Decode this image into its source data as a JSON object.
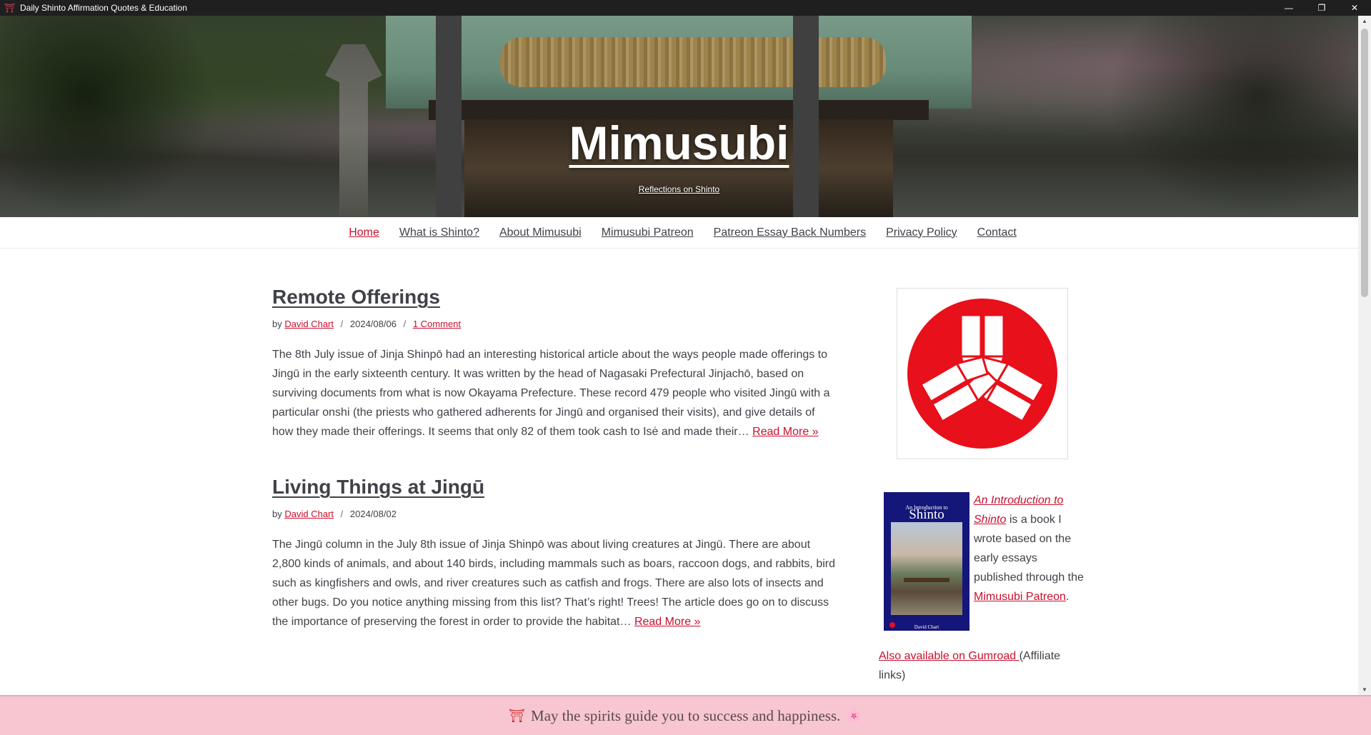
{
  "window": {
    "title": "Daily Shinto Affirmation Quotes & Education",
    "icon": "torii-icon",
    "controls": {
      "minimize": "—",
      "restore": "❐",
      "close": "✕"
    }
  },
  "hero": {
    "site_title": "Mimusubi",
    "tagline": "Reflections on Shinto"
  },
  "nav": {
    "items": [
      {
        "label": "Home",
        "active": true
      },
      {
        "label": "What is Shinto?"
      },
      {
        "label": "About Mimusubi"
      },
      {
        "label": "Mimusubi Patreon"
      },
      {
        "label": "Patreon Essay Back Numbers"
      },
      {
        "label": "Privacy Policy"
      },
      {
        "label": "Contact"
      }
    ]
  },
  "posts": [
    {
      "title": "Remote Offerings",
      "by": "by",
      "author": "David Chart",
      "sep": "/",
      "date": "2024/08/06",
      "comments": "1 Comment",
      "excerpt": "The 8th July issue of Jinja Shinpō had an interesting historical article about the ways people made offerings to Jingū in the early sixteenth century. It was written by the head of Nagasaki Prefectural Jinjachō, based on surviving documents from what is now Okayama Prefecture. These record 479 people who visited Jingū with a particular onshi (the priests who gathered adherents for Jingū and organised their visits), and give details of how they made their offerings. It seems that only 82 of them took cash to Isė and made their…",
      "read_more": "Read More »"
    },
    {
      "title": "Living Things at Jingū",
      "by": "by",
      "author": "David Chart",
      "sep": "/",
      "date": "2024/08/02",
      "excerpt": "The Jingū column in the July 8th issue of Jinja Shinpō was about living creatures at Jingū. There are about 2,800 kinds of animals, and about 140 birds, including mammals such as boars, raccoon dogs, and rabbits, bird such as kingfishers and owls, and river creatures such as catfish and frogs. There are also lots of insects and other bugs. Do you notice anything missing from this list? That’s right! Trees! The article does go on to discuss the importance of preserving the forest in order to provide the habitat…",
      "read_more": "Read More »"
    }
  ],
  "sidebar": {
    "logo_icon": "mitsu-kashiwa-crest-icon",
    "logo_color": "#e8101a",
    "book": {
      "cover": {
        "subtitle": "An Introduction to",
        "title": "Shinto",
        "author": "David Chart"
      },
      "link_title": "An Introduction to Shinto",
      "text_1": " is a book I wrote based on the early essays published through the ",
      "patreon_link": "Mimusubi Patreon",
      "text_2": ".",
      "gumroad_link": "Also available on Gumroad ",
      "affiliate_note": "(Affiliate links)"
    }
  },
  "banner": {
    "text": "May the spirits guide you to success and happiness.",
    "left_icon": "⛩",
    "right_icon": "🌸"
  },
  "colors": {
    "accent": "#c8102e",
    "text": "#404248",
    "banner_bg": "#f7c6d0"
  }
}
